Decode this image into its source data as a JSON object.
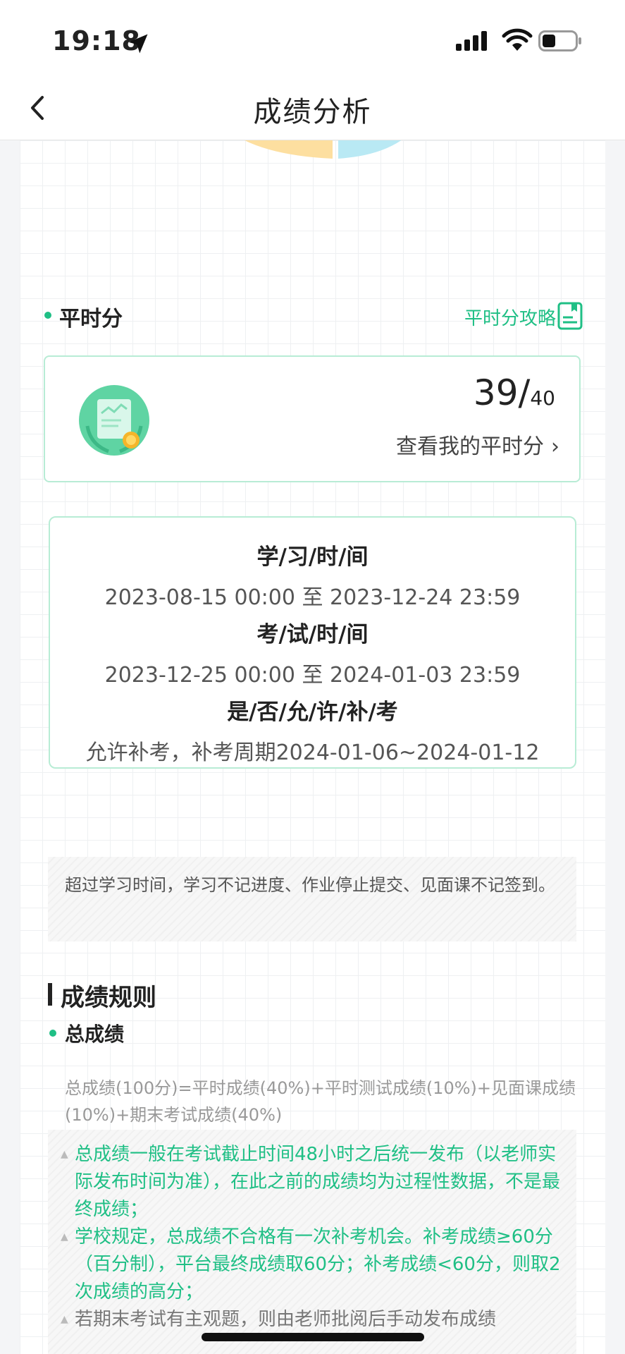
{
  "status_bar": {
    "time": "19:18"
  },
  "nav": {
    "title": "成绩分析"
  },
  "regular_score": {
    "section_title": "平时分",
    "guide_label": "平时分攻略",
    "score": "39/",
    "total": "40",
    "view_label": "查看我的平时分"
  },
  "schedule": {
    "study_label": "学/习/时/间",
    "study_value": "2023-08-15 00:00 至 2023-12-24 23:59",
    "exam_label": "考/试/时/间",
    "exam_value": "2023-12-25 00:00 至 2024-01-03 23:59",
    "makeup_label": "是/否/允/许/补/考",
    "makeup_value": "允许补考，补考周期2024-01-06~2024-01-12"
  },
  "notice": "超过学习时间，学习不记进度、作业停止提交、见面课不记签到。",
  "rules": {
    "title": "成绩规则",
    "total_title": "总成绩",
    "formula": "总成绩(100分)=平时成绩(40%)+平时测试成绩(10%)+见面课成绩(10%)+期末考试成绩(40%)",
    "notes": [
      "总成绩一般在考试截止时间48小时之后统一发布（以老师实际发布时间为准），在此之前的成绩均为过程性数据，不是最终成绩；",
      "学校规定，总成绩不合格有一次补考机会。补考成绩≥60分（百分制），平台最终成绩取60分；补考成绩<60分，则取2次成绩的高分；",
      "若期末考试有主观题，则由老师批阅后手动发布成绩"
    ]
  },
  "colors": {
    "accent": "#1fbf85",
    "card_border": "#b8ecd5"
  }
}
